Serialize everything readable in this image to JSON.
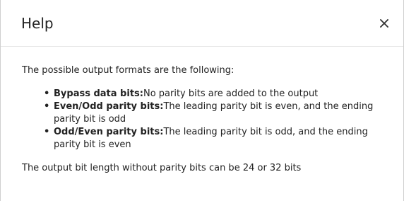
{
  "dialog": {
    "title": "Help",
    "close_icon": "close-icon",
    "close_glyph": "×"
  },
  "body": {
    "intro": "The possible output formats are the following:",
    "formats": [
      {
        "term": "Bypass data bits:",
        "description": "No parity bits are added to the output"
      },
      {
        "term": "Even/Odd parity bits:",
        "description": "The leading parity bit is even, and the ending parity bit is odd"
      },
      {
        "term": "Odd/Even parity bits:",
        "description": "The leading parity bit is odd, and the ending parity bit is even"
      }
    ],
    "footer": "The output bit length without parity bits can be 24 or 32 bits"
  }
}
